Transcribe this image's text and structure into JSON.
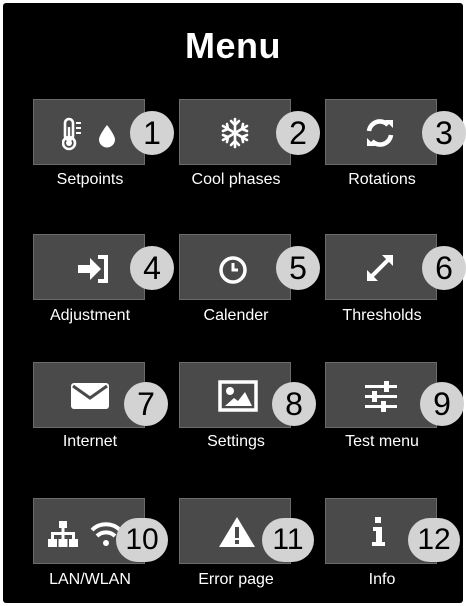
{
  "title": "Menu",
  "colors": {
    "background": "#000000",
    "tile": "#4a4a4a",
    "badge": "#d3d3d3",
    "text": "#ffffff"
  },
  "items": [
    {
      "number": "1",
      "label": "Setpoints",
      "icons": [
        "thermometer-icon",
        "water-drop-icon"
      ]
    },
    {
      "number": "2",
      "label": "Cool phases",
      "icons": [
        "snowflake-icon"
      ]
    },
    {
      "number": "3",
      "label": "Rotations",
      "icons": [
        "sync-icon"
      ]
    },
    {
      "number": "4",
      "label": "Adjustment",
      "icons": [
        "sign-in-icon"
      ]
    },
    {
      "number": "5",
      "label": "Calender",
      "icons": [
        "clock-icon"
      ]
    },
    {
      "number": "6",
      "label": "Thresholds",
      "icons": [
        "expand-icon"
      ]
    },
    {
      "number": "7",
      "label": "Internet",
      "icons": [
        "envelope-icon"
      ]
    },
    {
      "number": "8",
      "label": "Settings",
      "icons": [
        "image-icon"
      ]
    },
    {
      "number": "9",
      "label": "Test menu",
      "icons": [
        "sliders-icon"
      ]
    },
    {
      "number": "10",
      "label": "LAN/WLAN",
      "icons": [
        "network-icon",
        "wifi-icon"
      ]
    },
    {
      "number": "11",
      "label": "Error page",
      "icons": [
        "warning-icon"
      ]
    },
    {
      "number": "12",
      "label": "Info",
      "icons": [
        "info-icon"
      ]
    }
  ]
}
